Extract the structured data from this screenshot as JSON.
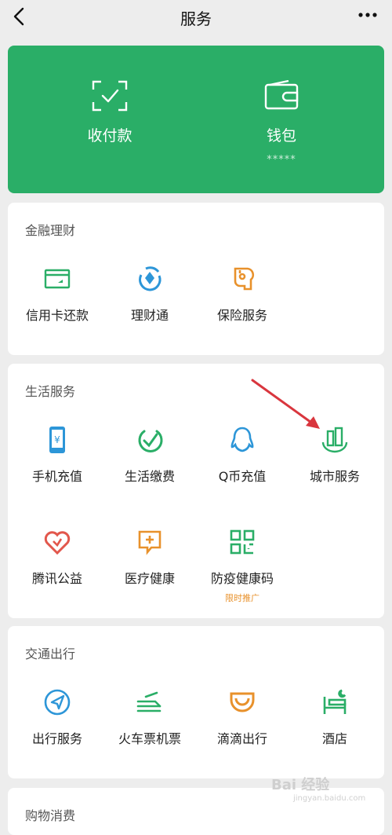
{
  "header": {
    "title": "服务"
  },
  "pay_card": {
    "items": [
      {
        "label": "收付款",
        "icon": "scan-pay-icon"
      },
      {
        "label": "钱包",
        "icon": "wallet-icon",
        "sub": "*****"
      }
    ]
  },
  "sections": [
    {
      "title": "金融理财",
      "items": [
        {
          "label": "信用卡还款",
          "icon": "credit-card-icon"
        },
        {
          "label": "理财通",
          "icon": "wealth-icon"
        },
        {
          "label": "保险服务",
          "icon": "insurance-icon"
        }
      ]
    },
    {
      "title": "生活服务",
      "items": [
        {
          "label": "手机充值",
          "icon": "phone-recharge-icon"
        },
        {
          "label": "生活缴费",
          "icon": "utility-bill-icon"
        },
        {
          "label": "Q币充值",
          "icon": "qq-coin-icon"
        },
        {
          "label": "城市服务",
          "icon": "city-service-icon"
        },
        {
          "label": "腾讯公益",
          "icon": "charity-icon"
        },
        {
          "label": "医疗健康",
          "icon": "medical-icon"
        },
        {
          "label": "防疫健康码",
          "icon": "health-code-icon",
          "tag": "限时推广"
        }
      ]
    },
    {
      "title": "交通出行",
      "items": [
        {
          "label": "出行服务",
          "icon": "travel-icon"
        },
        {
          "label": "火车票机票",
          "icon": "train-ticket-icon"
        },
        {
          "label": "滴滴出行",
          "icon": "didi-icon"
        },
        {
          "label": "酒店",
          "icon": "hotel-icon"
        }
      ]
    },
    {
      "title": "购物消费",
      "items": []
    }
  ],
  "watermark": {
    "main": "Bai 经验",
    "sub": "jingyan.baidu.com"
  },
  "colors": {
    "green": "#2aae67",
    "orange": "#e8912b",
    "red": "#e2574c",
    "blue": "#2d96d8",
    "arrow": "#d9363e"
  }
}
